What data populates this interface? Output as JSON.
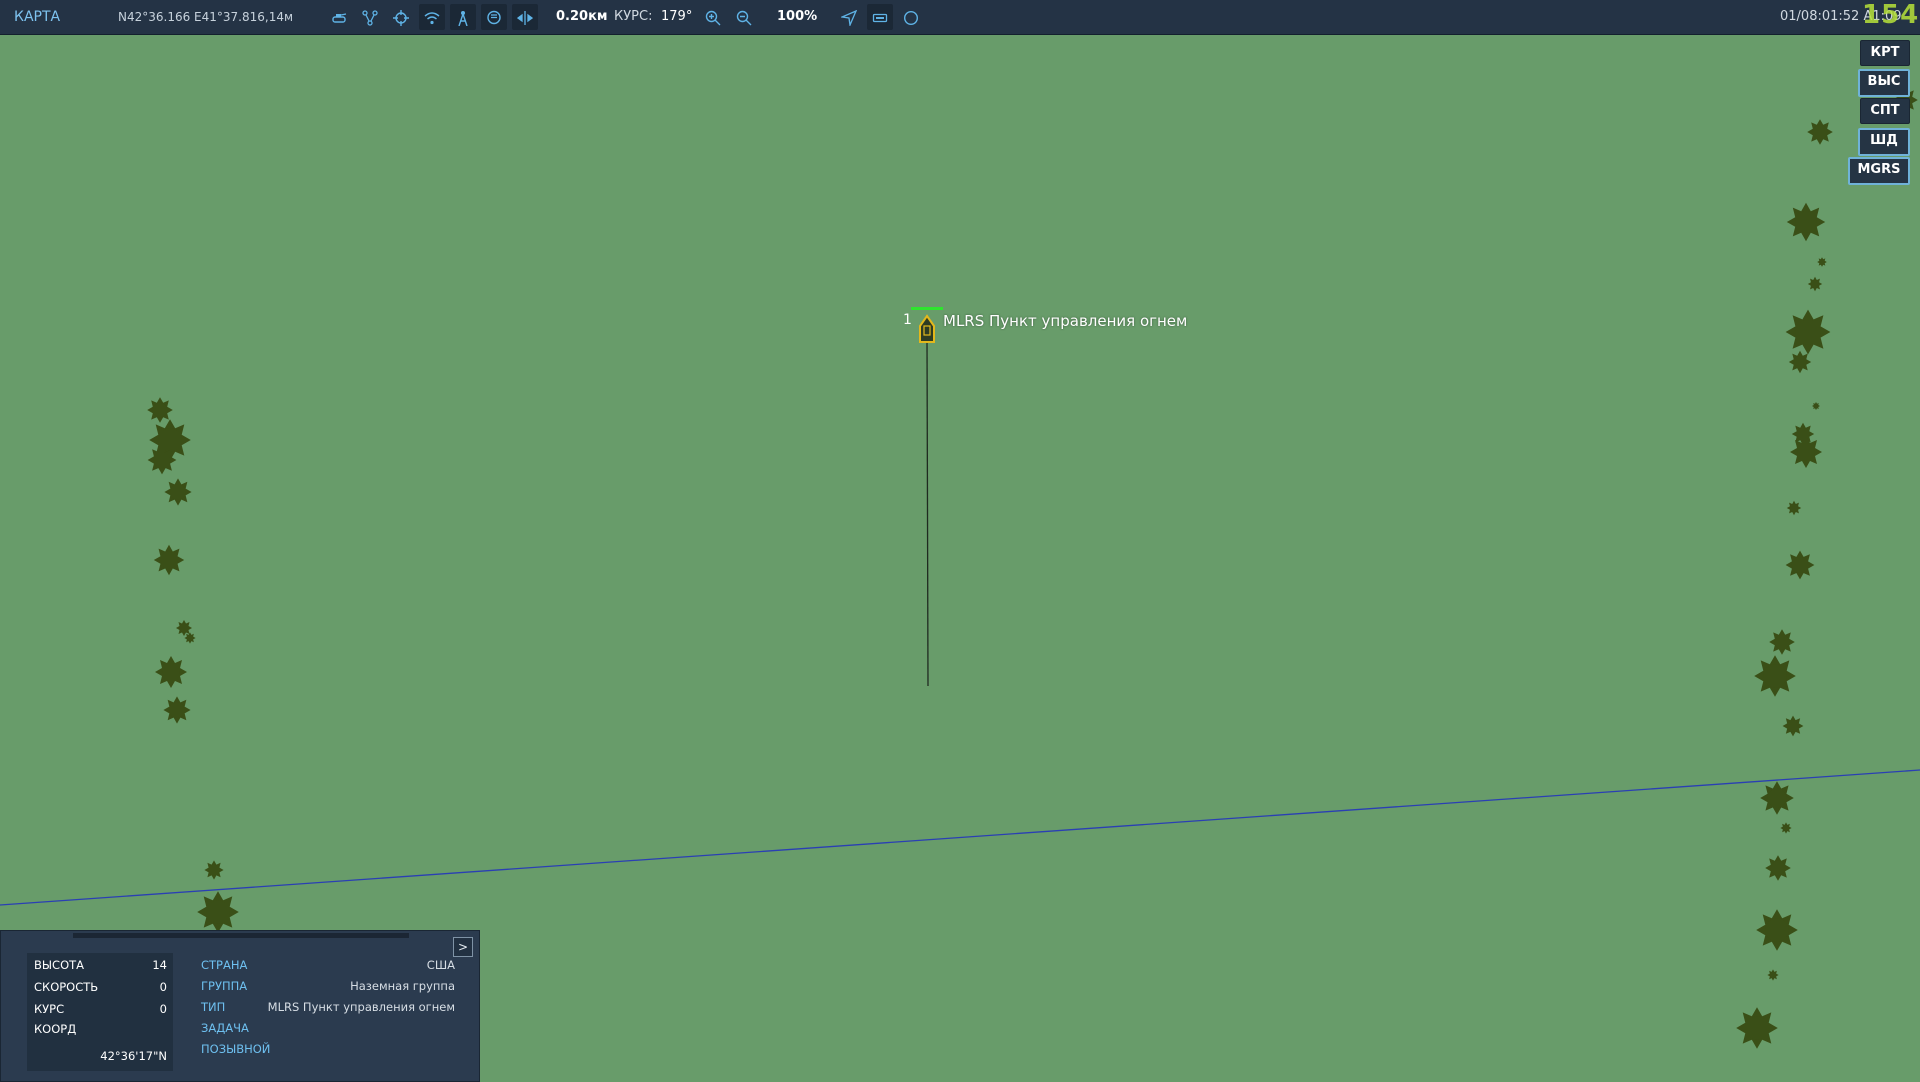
{
  "topbar": {
    "title": "КАРТА",
    "coords": "N42°36.166 E41°37.816,14м",
    "scale": "0.20км",
    "heading_label": "КУРС:",
    "heading_value": "179°",
    "zoom": "100%",
    "time": "01/08:01:52 A1:09",
    "logo": "154",
    "icons": [
      "tank-icon",
      "route-icon",
      "target-icon",
      "wifi-icon",
      "tower-icon",
      "chat-icon",
      "ruler-icon",
      "zoom-in-icon",
      "zoom-out-icon",
      "navigate-icon",
      "rectangle-icon",
      "circle-icon"
    ]
  },
  "side_buttons": [
    {
      "label": "КРТ",
      "selected": false
    },
    {
      "label": "ВЫС",
      "selected": true
    },
    {
      "label": "СПТ",
      "selected": false
    },
    {
      "label": "ШД",
      "selected": true
    },
    {
      "label": "MGRS",
      "selected": true
    }
  ],
  "map": {
    "unit_number": "1",
    "unit_label": "MLRS Пункт управления огнем",
    "colors": {
      "terrain": "#689c6a",
      "trees": "#3a4f17",
      "unit_outline": "#e3b81c",
      "health_bar": "#2ee52e",
      "bearing_line": "#2a3fb4"
    }
  },
  "panel": {
    "expand_label": ">",
    "left_rows": [
      {
        "key": "ВЫСОТА",
        "value": "14"
      },
      {
        "key": "СКОРОСТЬ",
        "value": "0"
      },
      {
        "key": "КУРС",
        "value": "0"
      },
      {
        "key": "КООРД",
        "value": ""
      }
    ],
    "coord_value": "42°36'17\"N",
    "right_rows": [
      {
        "key": "СТРАНА",
        "value": "США"
      },
      {
        "key": "ГРУППА",
        "value": "Наземная группа"
      },
      {
        "key": "ТИП",
        "value": "MLRS Пункт управления огнем"
      },
      {
        "key": "ЗАДАЧА",
        "value": ""
      },
      {
        "key": "ПОЗЫВНОЙ",
        "value": ""
      }
    ]
  }
}
